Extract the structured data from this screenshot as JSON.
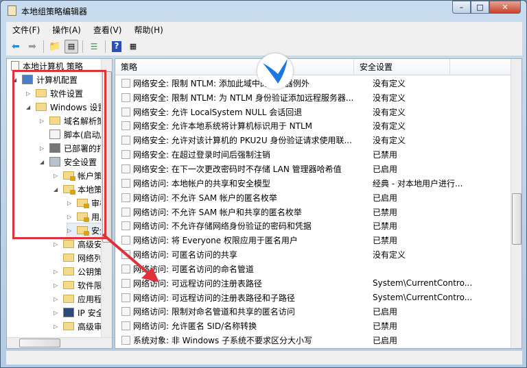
{
  "window": {
    "title": "本地组策略编辑器",
    "buttons": [
      "–",
      "□",
      "✕"
    ]
  },
  "menu": [
    "文件(F)",
    "操作(A)",
    "查看(V)",
    "帮助(H)"
  ],
  "toolbar": [
    "back-icon",
    "forward-icon",
    "up-folder-icon",
    "show-hide-tree-icon",
    "export-list-icon",
    "help-icon",
    "properties-icon"
  ],
  "tree": {
    "root": "本地计算机 策略",
    "items": [
      {
        "label": "计算机配置",
        "level": 0,
        "expander": "open",
        "icon": "computer"
      },
      {
        "label": "软件设置",
        "level": 1,
        "expander": "closed",
        "icon": "folder"
      },
      {
        "label": "Windows 设置",
        "level": 1,
        "expander": "open",
        "icon": "folder"
      },
      {
        "label": "域名解析策略",
        "level": 2,
        "expander": "closed",
        "icon": "folder"
      },
      {
        "label": "脚本(启动/关机)",
        "level": 2,
        "expander": "none",
        "icon": "script"
      },
      {
        "label": "已部署的打印机",
        "level": 2,
        "expander": "closed",
        "icon": "printer"
      },
      {
        "label": "安全设置",
        "level": 2,
        "expander": "open",
        "icon": "security"
      },
      {
        "label": "帐户策略",
        "level": 3,
        "expander": "closed",
        "icon": "lockfolder"
      },
      {
        "label": "本地策略",
        "level": 3,
        "expander": "open",
        "icon": "lockfolder"
      },
      {
        "label": "审核策略",
        "level": 4,
        "expander": "closed",
        "icon": "lockfolder"
      },
      {
        "label": "用户权限分配",
        "level": 4,
        "expander": "closed",
        "icon": "lockfolder"
      },
      {
        "label": "安全选项",
        "level": 4,
        "expander": "closed",
        "icon": "lockfolder",
        "selected": true
      },
      {
        "label": "高级安全 Windows 防火墙",
        "level": 3,
        "expander": "closed",
        "icon": "folder"
      },
      {
        "label": "网络列表管理器策略",
        "level": 3,
        "expander": "none",
        "icon": "folder"
      },
      {
        "label": "公钥策略",
        "level": 3,
        "expander": "closed",
        "icon": "folder"
      },
      {
        "label": "软件限制策略",
        "level": 3,
        "expander": "closed",
        "icon": "folder"
      },
      {
        "label": "应用程序控制策略",
        "level": 3,
        "expander": "closed",
        "icon": "folder"
      },
      {
        "label": "IP 安全策略",
        "level": 3,
        "expander": "closed",
        "icon": "ipsec"
      },
      {
        "label": "高级审核策略配置",
        "level": 3,
        "expander": "closed",
        "icon": "folder"
      }
    ]
  },
  "list": {
    "columns": [
      "策略",
      "安全设置"
    ],
    "rows": [
      {
        "policy": "网络安全: 限制 NTLM: 添加此域中的服务器例外",
        "setting": "没有定义"
      },
      {
        "policy": "网络安全: 限制 NTLM: 为 NTLM 身份验证添加远程服务器...",
        "setting": "没有定义"
      },
      {
        "policy": "网络安全: 允许 LocalSystem NULL 会话回退",
        "setting": "没有定义"
      },
      {
        "policy": "网络安全: 允许本地系统将计算机标识用于 NTLM",
        "setting": "没有定义"
      },
      {
        "policy": "网络安全: 允许对该计算机的 PKU2U 身份验证请求使用联...",
        "setting": "没有定义"
      },
      {
        "policy": "网络安全: 在超过登录时间后强制注销",
        "setting": "已禁用"
      },
      {
        "policy": "网络安全: 在下一次更改密码时不存储 LAN 管理器哈希值",
        "setting": "已启用"
      },
      {
        "policy": "网络访问: 本地帐户的共享和安全模型",
        "setting": "经典 - 对本地用户进行..."
      },
      {
        "policy": "网络访问: 不允许 SAM 帐户的匿名枚举",
        "setting": "已启用"
      },
      {
        "policy": "网络访问: 不允许 SAM 帐户和共享的匿名枚举",
        "setting": "已禁用"
      },
      {
        "policy": "网络访问: 不允许存储网络身份验证的密码和凭据",
        "setting": "已禁用"
      },
      {
        "policy": "网络访问: 将 Everyone 权限应用于匿名用户",
        "setting": "已禁用"
      },
      {
        "policy": "网络访问: 可匿名访问的共享",
        "setting": "没有定义"
      },
      {
        "policy": "网络访问: 可匿名访问的命名管道",
        "setting": ""
      },
      {
        "policy": "网络访问: 可远程访问的注册表路径",
        "setting": "System\\CurrentContro..."
      },
      {
        "policy": "网络访问: 可远程访问的注册表路径和子路径",
        "setting": "System\\CurrentContro..."
      },
      {
        "policy": "网络访问: 限制对命名管道和共享的匿名访问",
        "setting": "已启用"
      },
      {
        "policy": "网络访问: 允许匿名 SID/名称转换",
        "setting": "已禁用"
      },
      {
        "policy": "系统对象: 非 Windows 子系统不要求区分大小写",
        "setting": "已启用"
      }
    ]
  },
  "annotation_color": "#e0303a"
}
